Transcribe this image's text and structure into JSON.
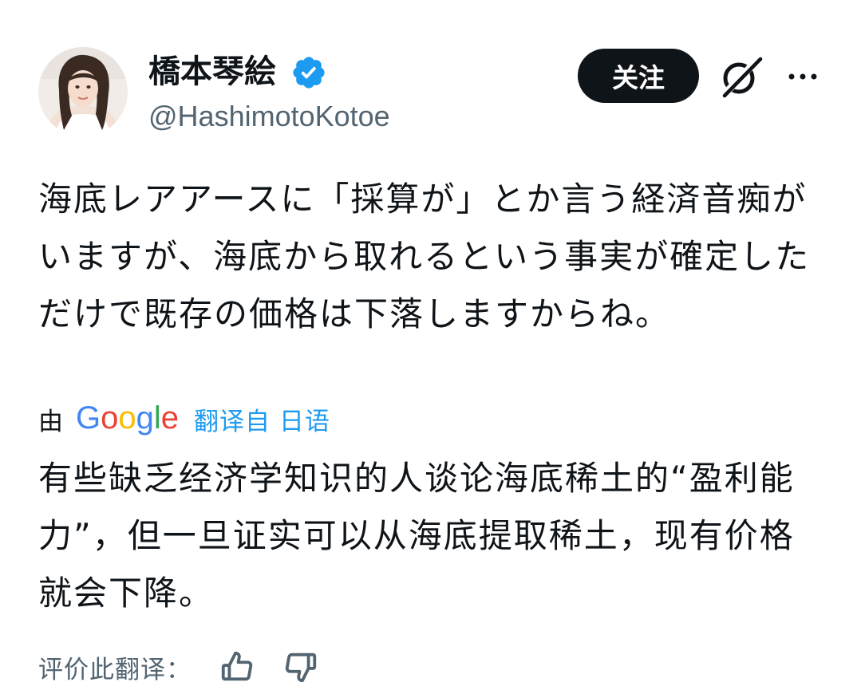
{
  "author": {
    "display_name": "橋本琴絵",
    "handle": "@HashimotoKotoe",
    "verified": true
  },
  "actions": {
    "follow_label": "关注",
    "grok_icon": "grok-icon",
    "more_icon": "more-dots-icon"
  },
  "tweet": {
    "text": "海底レアアースに「採算が」とか言う経済音痴がいますが、海底から取れるという事実が確定しただけで既存の価格は下落しますからね。"
  },
  "translation": {
    "by_label": "由",
    "provider": "Google",
    "from_label": "翻译自 日语",
    "text": "有些缺乏经济学知识的人谈论海底稀土的“盈利能力”，但一旦证实可以从海底提取稀土，现有价格就会下降。",
    "rate_label": "评价此翻译："
  },
  "colors": {
    "text": "#0f1419",
    "secondary": "#536471",
    "link": "#1d9bf0",
    "button_bg": "#0f1419"
  }
}
